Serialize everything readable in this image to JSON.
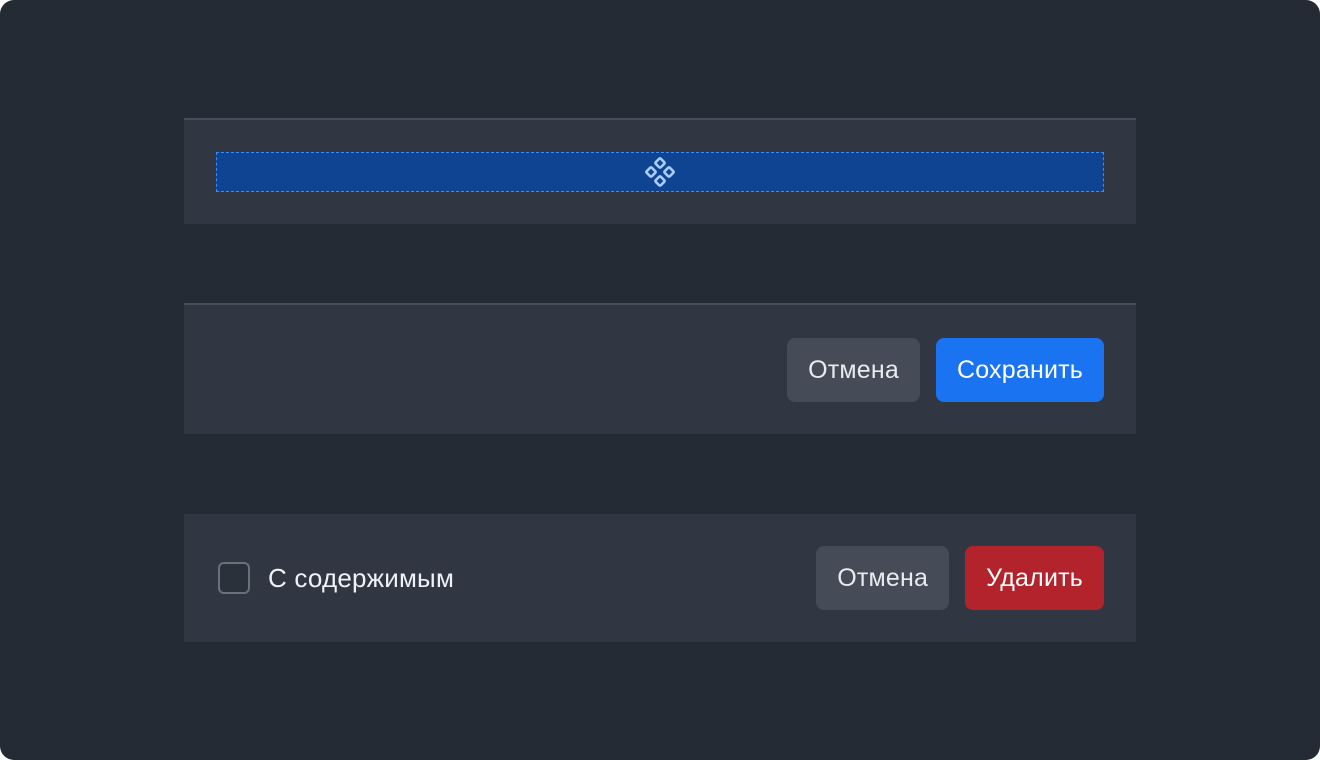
{
  "colors": {
    "background": "#252b35",
    "panel": "#313742",
    "drop_zone_fill": "#0f4493",
    "drop_zone_border": "#3f8cf0",
    "primary": "#1a73f0",
    "danger": "#b3232b",
    "secondary": "#464c57"
  },
  "drop_zone": {
    "icon": "component-diamonds-icon"
  },
  "save_footer": {
    "cancel_label": "Отмена",
    "save_label": "Сохранить"
  },
  "delete_footer": {
    "checkbox_label": "С содержимым",
    "checkbox_checked": false,
    "cancel_label": "Отмена",
    "delete_label": "Удалить"
  }
}
